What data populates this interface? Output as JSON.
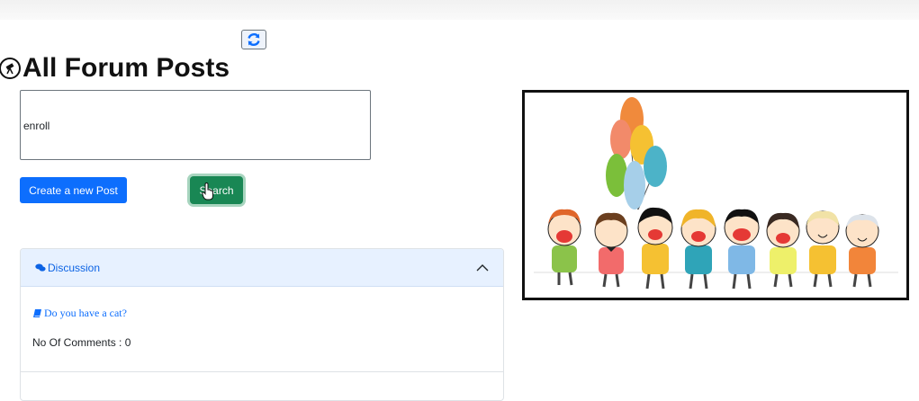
{
  "header": {
    "title": "All Forum Posts",
    "title_icon": "telescope-circle-icon",
    "refresh_icon": "refresh-icon"
  },
  "search": {
    "value": "enroll"
  },
  "buttons": {
    "create_label": "Create a new Post",
    "search_label": "Search"
  },
  "accordion": {
    "header_label": "Discussion",
    "header_icon": "comments-icon",
    "expanded": true,
    "posts": [
      {
        "title": "Do you have a cat?",
        "icon": "book-icon",
        "comments_label": "No Of Comments : 0"
      }
    ]
  },
  "illustration": {
    "subject": "cartoon children holding hands with balloons",
    "balloon_colors": [
      "#f08a3c",
      "#f5c132",
      "#4cb3c8",
      "#7bbf3a",
      "#a6cfe9",
      "#f06b3a"
    ]
  },
  "colors": {
    "primary": "#0d6efd",
    "success": "#198754",
    "accordion_bg": "#e7f1ff"
  }
}
